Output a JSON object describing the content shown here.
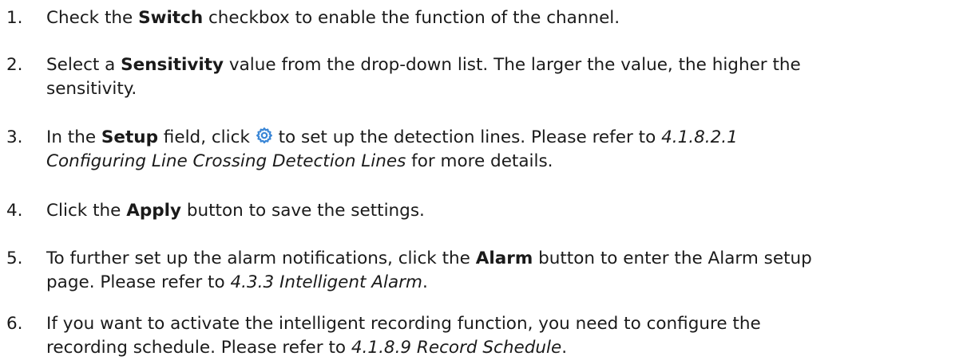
{
  "steps": [
    {
      "number": "1.",
      "lines": [
        {
          "pre": "Check the ",
          "bold": "Switch",
          "post": " checkbox to enable the function of the channel."
        }
      ]
    },
    {
      "number": "2.",
      "lines": [
        {
          "pre": "Select a ",
          "bold": "Sensitivity",
          "post": " value from the drop-down list. The larger the value, the higher the"
        },
        {
          "text": "sensitivity."
        }
      ]
    },
    {
      "number": "3.",
      "lines": [
        {
          "pre": "In the ",
          "bold": "Setup",
          "mid": " field, click ",
          "post": " to set up the detection lines. Please refer to ",
          "italic": "4.1.8.2.1"
        },
        {
          "italic": "Configuring Line Crossing Detection Lines",
          "post": " for more details."
        }
      ],
      "icon": "gear-icon"
    },
    {
      "number": "4.",
      "lines": [
        {
          "pre": "Click the ",
          "bold": "Apply",
          "post": " button to save the settings."
        }
      ]
    },
    {
      "number": "5.",
      "lines": [
        {
          "pre": "To further set up the alarm notifications, click the ",
          "bold": "Alarm",
          "post": " button to enter the Alarm setup"
        },
        {
          "pre": "page. Please refer to ",
          "italic": "4.3.3 Intelligent Alarm",
          "post": "."
        }
      ]
    },
    {
      "number": "6.",
      "lines": [
        {
          "text": "If you want to activate the intelligent recording function, you need to configure the"
        },
        {
          "pre": "recording schedule. Please refer to ",
          "italic": "4.1.8.9 Record Schedule",
          "post": "."
        }
      ]
    }
  ],
  "colors": {
    "text": "#1a1a1a",
    "icon_blue": "#3a86d6"
  }
}
